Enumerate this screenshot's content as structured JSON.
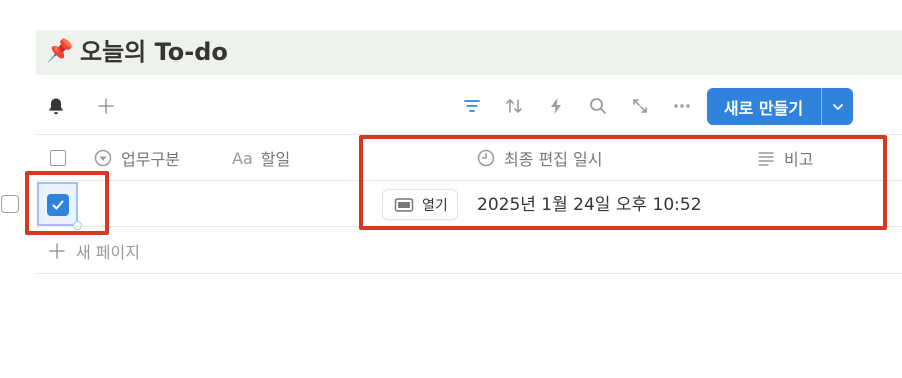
{
  "title": {
    "emoji": "📌",
    "text": "오늘의 To-do"
  },
  "toolbar": {
    "left_icons": [
      "bell-icon",
      "plus-icon"
    ],
    "right_icons": [
      "filter-icon",
      "sort-icon",
      "automation-icon",
      "search-icon",
      "expand-icon",
      "more-icon"
    ],
    "new_button_label": "새로 만들기",
    "accent_color": "#2f83dd"
  },
  "columns": [
    {
      "icon": "status-icon",
      "label": "업무구분"
    },
    {
      "icon": "text-icon",
      "prefix": "Aa",
      "label": "할일"
    },
    {
      "icon": "clock-icon",
      "label": "최종 편집 일시"
    },
    {
      "icon": "lines-icon",
      "label": "비고"
    }
  ],
  "rows": [
    {
      "checked": true,
      "open_label": "열기",
      "last_edited": "2025년 1월 24일 오후 10:52"
    }
  ],
  "new_page_label": "새 페이지",
  "annotation_color": "#d33a20"
}
